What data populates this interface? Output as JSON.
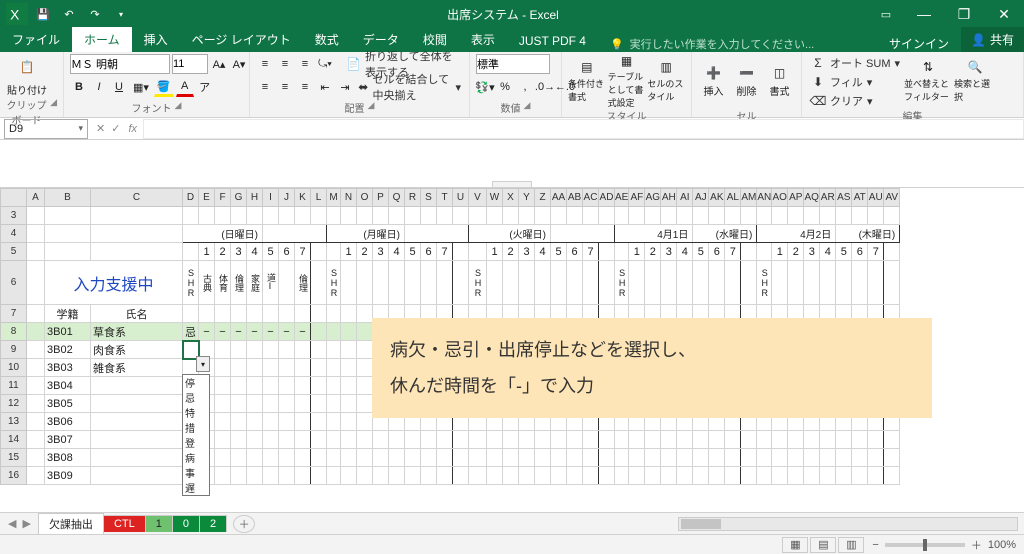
{
  "window": {
    "title": "出席システム - Excel"
  },
  "qat": {
    "save": "save-icon",
    "undo": "undo-icon",
    "redo": "redo-icon"
  },
  "tabs": {
    "file": "ファイル",
    "home": "ホーム",
    "insert": "挿入",
    "layout": "ページ レイアウト",
    "formulas": "数式",
    "data": "データ",
    "review": "校閲",
    "view": "表示",
    "justpdf": "JUST PDF 4",
    "tell": "実行したい作業を入力してください...",
    "signin": "サインイン",
    "share": "共有"
  },
  "ribbon": {
    "clipboard": {
      "paste": "貼り付け",
      "label": "クリップボード"
    },
    "font": {
      "name": "ＭＳ 明朝",
      "size": "11",
      "label": "フォント"
    },
    "align": {
      "wrap": "折り返して全体を表示する",
      "merge": "セルを結合して中央揃え",
      "label": "配置"
    },
    "number": {
      "format": "標準",
      "label": "数値"
    },
    "styles": {
      "condfmt": "条件付き書式",
      "tablefmt": "テーブルとして書式設定",
      "cellstyle": "セルのスタイル",
      "label": "スタイル"
    },
    "cells": {
      "insert": "挿入",
      "delete": "削除",
      "format": "書式",
      "label": "セル"
    },
    "editing": {
      "autosum": "オート SUM",
      "fill": "フィル",
      "clear": "クリア",
      "sort": "並べ替えとフィルター",
      "find": "検索と選択",
      "label": "編集"
    }
  },
  "namebox": "D9",
  "sheet": {
    "input_assist": "入力支援中",
    "col_gakuseki": "学籍",
    "col_shimei": "氏名",
    "shr": "SHR",
    "period_labels": [
      "古典",
      "体育",
      "倫理",
      "家庭",
      "道Ⅰ",
      "",
      "倫理"
    ],
    "periods": [
      "1",
      "2",
      "3",
      "4",
      "5",
      "6",
      "7"
    ],
    "day_headers": [
      "(日曜日)",
      "(月曜日)",
      "(火曜日)",
      "4月1日",
      "(水曜日)",
      "4月2日",
      "(木曜日)"
    ],
    "rows": [
      {
        "id": "3B01",
        "name": "草食系",
        "mark": "忌",
        "dash": "−"
      },
      {
        "id": "3B02",
        "name": "肉食系"
      },
      {
        "id": "3B03",
        "name": "雑食系"
      },
      {
        "id": "3B04",
        "name": ""
      },
      {
        "id": "3B05",
        "name": ""
      },
      {
        "id": "3B06",
        "name": ""
      },
      {
        "id": "3B07",
        "name": ""
      },
      {
        "id": "3B08",
        "name": ""
      },
      {
        "id": "3B09",
        "name": ""
      }
    ],
    "dropdown": [
      "停",
      "忌",
      "特",
      "措",
      "登",
      "病",
      "事",
      "遅"
    ]
  },
  "annotation": {
    "line1": "病欠・忌引・出席停止などを選択し、",
    "line2": "休んだ時間を「-」で入力"
  },
  "sheettabs": {
    "t1": "欠課抽出",
    "t2": "CTL",
    "t3": "1",
    "t4": "0",
    "t5": "2"
  },
  "status": {
    "zoom": "100%",
    "minus": "−",
    "plus": "＋"
  },
  "colheads": [
    "A",
    "B",
    "C",
    "D",
    "E",
    "F",
    "G",
    "H",
    "I",
    "J",
    "K",
    "L",
    "M",
    "N",
    "O",
    "P",
    "Q",
    "R",
    "S",
    "T",
    "U",
    "V",
    "W",
    "X",
    "Y",
    "Z",
    "AA",
    "AB",
    "AC",
    "AD",
    "AE",
    "AF",
    "AG",
    "AH",
    "AI",
    "AJ",
    "AK",
    "AL",
    "AM",
    "AN",
    "AO",
    "AP",
    "AQ",
    "AR",
    "AS",
    "AT",
    "AU",
    "AV"
  ]
}
